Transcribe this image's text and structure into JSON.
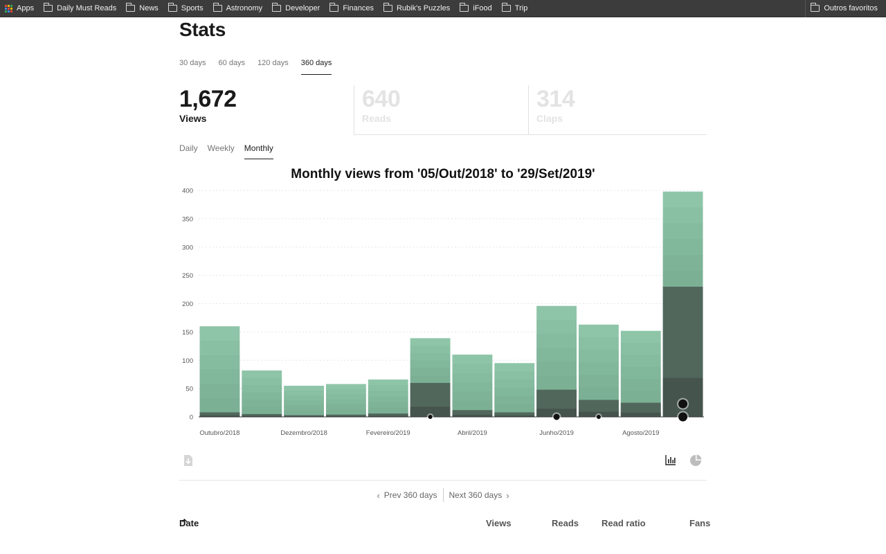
{
  "bookmarks": {
    "items": [
      "Apps",
      "Daily Must Reads",
      "News",
      "Sports",
      "Astronomy",
      "Developer",
      "Finances",
      "Rubik's Puzzles",
      "iFood",
      "Trip"
    ],
    "other": "Outros favoritos"
  },
  "page": {
    "title": "Stats",
    "range_tabs": [
      "30 days",
      "60 days",
      "120 days",
      "360 days"
    ],
    "range_active": "360 days",
    "metrics": [
      {
        "value": "1,672",
        "label": "Views"
      },
      {
        "value": "640",
        "label": "Reads"
      },
      {
        "value": "314",
        "label": "Claps"
      }
    ],
    "period_tabs": [
      "Daily",
      "Weekly",
      "Monthly"
    ],
    "period_active": "Monthly",
    "pager": {
      "prev": "Prev 360 days",
      "next": "Next 360 days"
    },
    "table_headers": {
      "date": "Date",
      "sort_icon": "arrow-up-icon",
      "views": "Views",
      "reads": "Reads",
      "read_ratio": "Read ratio",
      "fans": "Fans"
    },
    "tools": {
      "export_icon": "download-file-icon",
      "bar_icon": "bar-chart-icon",
      "pie_icon": "pie-chart-icon"
    }
  },
  "colors": {
    "bar_light": "#8ec5a8",
    "bar_dark": "#4a5a52",
    "grid": "#e5e5e5",
    "axis": "#333333"
  },
  "chart_data": {
    "type": "bar",
    "title": "Monthly views from '05/Out/2018' to '29/Set/2019'",
    "ylim": [
      0,
      400
    ],
    "yticks": [
      0,
      50,
      100,
      150,
      200,
      250,
      300,
      350,
      400
    ],
    "x_tick_labels": [
      "Outubro/2018",
      "Dezembro/2018",
      "Fevereiro/2019",
      "Abril/2019",
      "Junho/2019",
      "Agosto/2019"
    ],
    "x_tick_month_index": [
      0,
      2,
      4,
      6,
      8,
      10
    ],
    "values": [
      160,
      82,
      55,
      58,
      66,
      139,
      110,
      95,
      196,
      163,
      152,
      398
    ],
    "dark_values": [
      8,
      5,
      3,
      4,
      6,
      60,
      12,
      8,
      48,
      30,
      25,
      230
    ],
    "markers": [
      {
        "month": 5,
        "y": 0,
        "size": "small"
      },
      {
        "month": 8,
        "y": 0,
        "size": "medium"
      },
      {
        "month": 9,
        "y": 0,
        "size": "small"
      },
      {
        "month": 11,
        "y": 23,
        "size": "large"
      },
      {
        "month": 11,
        "y": 0,
        "size": "large"
      }
    ],
    "grid": true
  }
}
